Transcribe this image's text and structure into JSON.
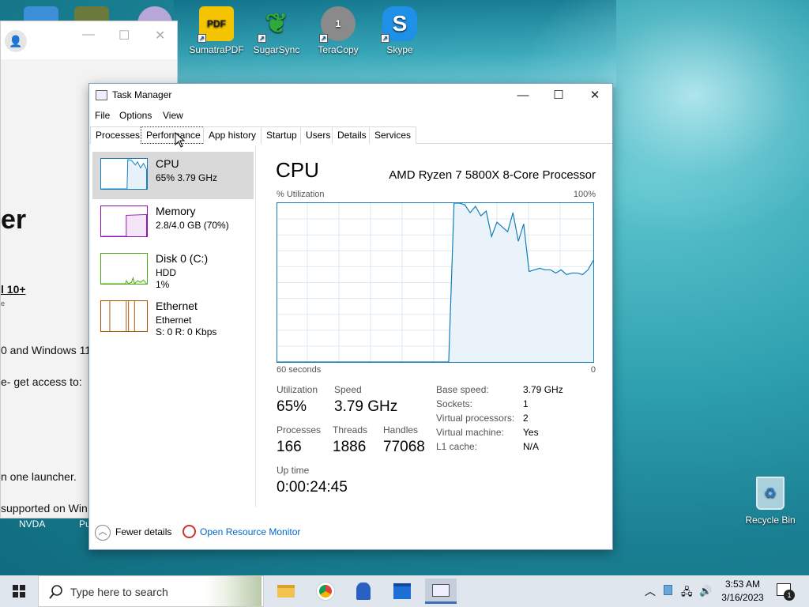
{
  "desktop": {
    "icons": [
      {
        "label": "",
        "name": "desktop-icon-partial-1"
      },
      {
        "label": "",
        "name": "desktop-icon-partial-2"
      },
      {
        "label": "",
        "name": "desktop-icon-partial-3"
      },
      {
        "label": "SumatraPDF",
        "glyph": "PDF",
        "color": "#f5c400"
      },
      {
        "label": "SugarSync",
        "glyph": "❦",
        "color": "#2eaa3a"
      },
      {
        "label": "TeraCopy",
        "glyph": "1",
        "color": "#8a8a8a"
      },
      {
        "label": "Skype",
        "glyph": "S",
        "color": "#1e90e8"
      }
    ],
    "recycle_bin": "Recycle Bin"
  },
  "background_window": {
    "title_partial": "r",
    "heading": "er",
    "link": "l 10+",
    "small": "e",
    "line1": "0 and Windows 11",
    "line2": "e- get access to:",
    "line3": "n one launcher.",
    "line4": "supported on Win",
    "bottom1": "NVDA",
    "bottom2": "Pu"
  },
  "task_manager": {
    "title": "Task Manager",
    "menu": [
      "File",
      "Options",
      "View"
    ],
    "tabs": [
      "Processes",
      "Performance",
      "App history",
      "Startup",
      "Users",
      "Details",
      "Services"
    ],
    "active_tab": "Performance",
    "resources": [
      {
        "name": "CPU",
        "line2": "65%  3.79 GHz",
        "line3": "",
        "color": "#117dbb"
      },
      {
        "name": "Memory",
        "line2": "2.8/4.0 GB (70%)",
        "line3": "",
        "color": "#8b12ae"
      },
      {
        "name": "Disk 0 (C:)",
        "line2": "HDD",
        "line3": "1%",
        "color": "#4da60c"
      },
      {
        "name": "Ethernet",
        "line2": "Ethernet",
        "line3": "S: 0  R: 0 Kbps",
        "color": "#a74f01"
      }
    ],
    "cpu": {
      "heading": "CPU",
      "processor": "AMD Ryzen 7 5800X 8-Core Processor",
      "util_label": "% Utilization",
      "max_label": "100%",
      "time_label": "60 seconds",
      "min_label": "0",
      "utilization_history": [
        0,
        0,
        0,
        0,
        0,
        0,
        0,
        0,
        0,
        0,
        0,
        0,
        0,
        0,
        0,
        0,
        0,
        0,
        0,
        0,
        0,
        0,
        0,
        0,
        0,
        0,
        0,
        0,
        0,
        0,
        0,
        0,
        0,
        100,
        100,
        99,
        94,
        98,
        92,
        95,
        79,
        88,
        85,
        82,
        94,
        76,
        87,
        57,
        58,
        59,
        58,
        58,
        56,
        58,
        55,
        56,
        56,
        55,
        58,
        64
      ],
      "stats": {
        "utilization_label": "Utilization",
        "utilization": "65%",
        "speed_label": "Speed",
        "speed": "3.79 GHz",
        "processes_label": "Processes",
        "processes": "166",
        "threads_label": "Threads",
        "threads": "1886",
        "handles_label": "Handles",
        "handles": "77068",
        "uptime_label": "Up time",
        "uptime": "0:00:24:45"
      },
      "details": [
        {
          "k": "Base speed:",
          "v": "3.79 GHz"
        },
        {
          "k": "Sockets:",
          "v": "1"
        },
        {
          "k": "Virtual processors:",
          "v": "2"
        },
        {
          "k": "Virtual machine:",
          "v": "Yes"
        },
        {
          "k": "L1 cache:",
          "v": "N/A"
        }
      ]
    },
    "footer": {
      "fewer": "Fewer details",
      "monitor": "Open Resource Monitor"
    }
  },
  "taskbar": {
    "search_placeholder": "Type here to search",
    "time": "3:53 AM",
    "date": "3/16/2023",
    "notification_count": "1"
  }
}
